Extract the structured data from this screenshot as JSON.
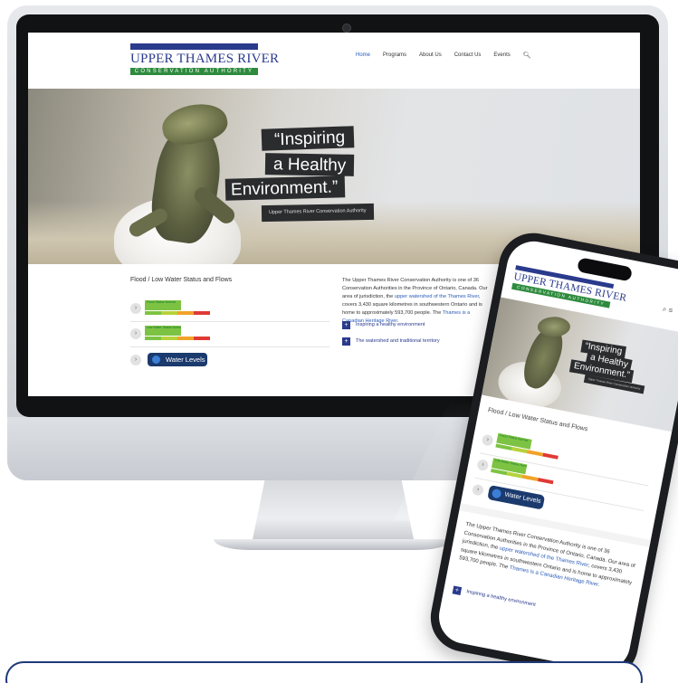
{
  "site": {
    "logo_title": "UPPER THAMES RIVER",
    "logo_subtitle": "CONSERVATION AUTHORITY",
    "nav": [
      "Home",
      "Programs",
      "About Us",
      "Contact Us",
      "Events"
    ],
    "hero_quote": [
      "“Inspiring",
      "a Healthy",
      "Environment.”"
    ],
    "hero_attribution": "Upper Thames River Conservation Authority",
    "flood_title": "Flood / Low Water Status and Flows",
    "flood_status_label": "Flood Status Normal",
    "low_water_label": "Low Water Status Normal",
    "water_levels_button": "Water Levels",
    "about_text_parts": [
      "The Upper Thames River Conservation Authority is one of 36 Conservation Authorities in the Province of Ontario, Canada. Our area of jurisdiction, the ",
      "upper watershed of the Thames River",
      ", covers 3,430 square kilometres in southwestern Ontario and is home to approximately 593,700 people. The ",
      "Thames is a Canadian Heritage River",
      "."
    ],
    "accordion": [
      "Inspiring a healthy environment",
      "The watershed and traditional territory"
    ]
  },
  "mobile": {
    "flood_title": "Flood / Low Water Status and Flows",
    "water_levels_button": "Water Levels",
    "accordion": [
      "Inspiring a healthy environment"
    ]
  },
  "colors": {
    "brand_blue": "#2a3a8c",
    "brand_green": "#2e8b3e",
    "link_blue": "#2a5bb8",
    "button_navy": "#1b3a6e",
    "meter": [
      "#7dc343",
      "#b7d23a",
      "#f0a32a",
      "#e03a35"
    ]
  },
  "icons": {
    "search": "search-icon",
    "menu": "menu-icon",
    "chevron": "chevron-right-icon",
    "plus": "plus-icon"
  }
}
